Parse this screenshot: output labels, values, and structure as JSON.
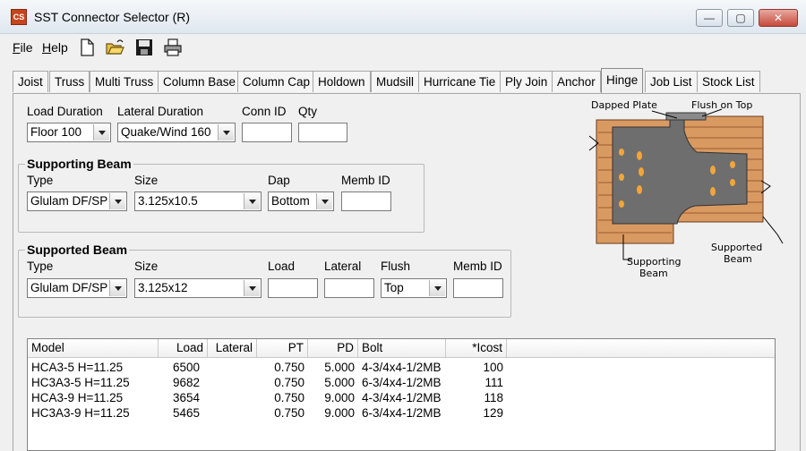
{
  "window": {
    "title": "SST Connector Selector (R)",
    "app_icon_text": "CS",
    "minimize_glyph": "—",
    "maximize_glyph": "▢",
    "close_glyph": "✕"
  },
  "menu": {
    "file_u": "F",
    "file_rest": "ile",
    "help_u": "H",
    "help_rest": "elp"
  },
  "toolbar": [
    "new-document-icon",
    "open-folder-icon",
    "save-disk-icon",
    "print-icon"
  ],
  "tabs": [
    "Joist",
    "Truss",
    "Multi Truss",
    "Column Base",
    "Column Cap",
    "Holdown",
    "Mudsill",
    "Hurricane Tie",
    "Ply Join",
    "Anchor",
    "Hinge",
    "Job List",
    "Stock List"
  ],
  "active_tab": "Hinge",
  "top_row": {
    "load_duration_label": "Load Duration",
    "load_duration_value": "Floor 100",
    "lateral_duration_label": "Lateral Duration",
    "lateral_duration_value": "Quake/Wind 160",
    "conn_id_label": "Conn ID",
    "conn_id_value": "",
    "qty_label": "Qty",
    "qty_value": ""
  },
  "supporting_beam": {
    "title": "Supporting Beam",
    "type_label": "Type",
    "type_value": "Glulam DF/SP",
    "size_label": "Size",
    "size_value": "3.125x10.5",
    "dap_label": "Dap",
    "dap_value": "Bottom",
    "memb_id_label": "Memb ID",
    "memb_id_value": ""
  },
  "supported_beam": {
    "title": "Supported Beam",
    "type_label": "Type",
    "type_value": "Glulam DF/SP",
    "size_label": "Size",
    "size_value": "3.125x12",
    "load_label": "Load",
    "load_value": "",
    "lateral_label": "Lateral",
    "lateral_value": "",
    "flush_label": "Flush",
    "flush_value": "Top",
    "memb_id_label": "Memb ID",
    "memb_id_value": ""
  },
  "diagram": {
    "dapped_plate": "Dapped Plate",
    "flush_on_top": "Flush on Top",
    "supporting_1": "Supporting",
    "supporting_2": "Beam",
    "supported_1": "Supported",
    "supported_2": "Beam",
    "colors": {
      "wood": "#d99a62",
      "wood_dark": "#9c5a2e",
      "plate": "#6e6e6e",
      "hole": "#f3a53a"
    }
  },
  "results": {
    "headers": [
      "Model",
      "Load",
      "Lateral",
      "PT",
      "PD",
      "Bolt",
      "*Icost"
    ],
    "rows": [
      [
        "HCA3-5 H=11.25",
        "6500",
        "",
        "0.750",
        "5.000",
        "4-3/4x4-1/2MB",
        "100"
      ],
      [
        "HC3A3-5 H=11.25",
        "9682",
        "",
        "0.750",
        "5.000",
        "6-3/4x4-1/2MB",
        "111"
      ],
      [
        "HCA3-9 H=11.25",
        "3654",
        "",
        "0.750",
        "9.000",
        "4-3/4x4-1/2MB",
        "118"
      ],
      [
        "HC3A3-9 H=11.25",
        "5465",
        "",
        "0.750",
        "9.000",
        "6-3/4x4-1/2MB",
        "129"
      ]
    ]
  }
}
